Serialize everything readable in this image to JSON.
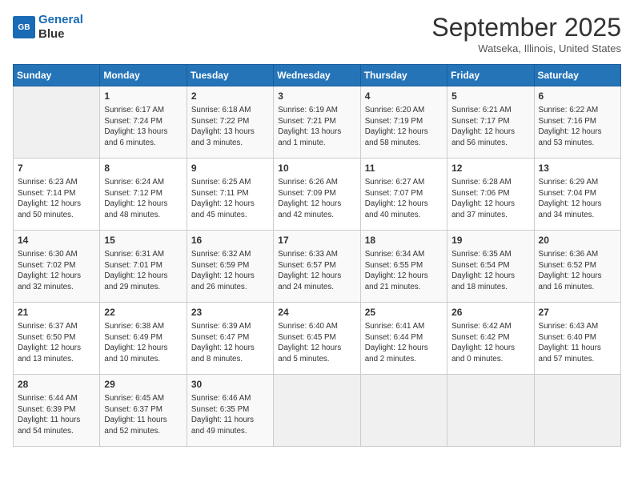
{
  "logo": {
    "line1": "General",
    "line2": "Blue"
  },
  "title": "September 2025",
  "location": "Watseka, Illinois, United States",
  "days_of_week": [
    "Sunday",
    "Monday",
    "Tuesday",
    "Wednesday",
    "Thursday",
    "Friday",
    "Saturday"
  ],
  "weeks": [
    [
      {
        "day": "",
        "info": ""
      },
      {
        "day": "1",
        "info": "Sunrise: 6:17 AM\nSunset: 7:24 PM\nDaylight: 13 hours\nand 6 minutes."
      },
      {
        "day": "2",
        "info": "Sunrise: 6:18 AM\nSunset: 7:22 PM\nDaylight: 13 hours\nand 3 minutes."
      },
      {
        "day": "3",
        "info": "Sunrise: 6:19 AM\nSunset: 7:21 PM\nDaylight: 13 hours\nand 1 minute."
      },
      {
        "day": "4",
        "info": "Sunrise: 6:20 AM\nSunset: 7:19 PM\nDaylight: 12 hours\nand 58 minutes."
      },
      {
        "day": "5",
        "info": "Sunrise: 6:21 AM\nSunset: 7:17 PM\nDaylight: 12 hours\nand 56 minutes."
      },
      {
        "day": "6",
        "info": "Sunrise: 6:22 AM\nSunset: 7:16 PM\nDaylight: 12 hours\nand 53 minutes."
      }
    ],
    [
      {
        "day": "7",
        "info": "Sunrise: 6:23 AM\nSunset: 7:14 PM\nDaylight: 12 hours\nand 50 minutes."
      },
      {
        "day": "8",
        "info": "Sunrise: 6:24 AM\nSunset: 7:12 PM\nDaylight: 12 hours\nand 48 minutes."
      },
      {
        "day": "9",
        "info": "Sunrise: 6:25 AM\nSunset: 7:11 PM\nDaylight: 12 hours\nand 45 minutes."
      },
      {
        "day": "10",
        "info": "Sunrise: 6:26 AM\nSunset: 7:09 PM\nDaylight: 12 hours\nand 42 minutes."
      },
      {
        "day": "11",
        "info": "Sunrise: 6:27 AM\nSunset: 7:07 PM\nDaylight: 12 hours\nand 40 minutes."
      },
      {
        "day": "12",
        "info": "Sunrise: 6:28 AM\nSunset: 7:06 PM\nDaylight: 12 hours\nand 37 minutes."
      },
      {
        "day": "13",
        "info": "Sunrise: 6:29 AM\nSunset: 7:04 PM\nDaylight: 12 hours\nand 34 minutes."
      }
    ],
    [
      {
        "day": "14",
        "info": "Sunrise: 6:30 AM\nSunset: 7:02 PM\nDaylight: 12 hours\nand 32 minutes."
      },
      {
        "day": "15",
        "info": "Sunrise: 6:31 AM\nSunset: 7:01 PM\nDaylight: 12 hours\nand 29 minutes."
      },
      {
        "day": "16",
        "info": "Sunrise: 6:32 AM\nSunset: 6:59 PM\nDaylight: 12 hours\nand 26 minutes."
      },
      {
        "day": "17",
        "info": "Sunrise: 6:33 AM\nSunset: 6:57 PM\nDaylight: 12 hours\nand 24 minutes."
      },
      {
        "day": "18",
        "info": "Sunrise: 6:34 AM\nSunset: 6:55 PM\nDaylight: 12 hours\nand 21 minutes."
      },
      {
        "day": "19",
        "info": "Sunrise: 6:35 AM\nSunset: 6:54 PM\nDaylight: 12 hours\nand 18 minutes."
      },
      {
        "day": "20",
        "info": "Sunrise: 6:36 AM\nSunset: 6:52 PM\nDaylight: 12 hours\nand 16 minutes."
      }
    ],
    [
      {
        "day": "21",
        "info": "Sunrise: 6:37 AM\nSunset: 6:50 PM\nDaylight: 12 hours\nand 13 minutes."
      },
      {
        "day": "22",
        "info": "Sunrise: 6:38 AM\nSunset: 6:49 PM\nDaylight: 12 hours\nand 10 minutes."
      },
      {
        "day": "23",
        "info": "Sunrise: 6:39 AM\nSunset: 6:47 PM\nDaylight: 12 hours\nand 8 minutes."
      },
      {
        "day": "24",
        "info": "Sunrise: 6:40 AM\nSunset: 6:45 PM\nDaylight: 12 hours\nand 5 minutes."
      },
      {
        "day": "25",
        "info": "Sunrise: 6:41 AM\nSunset: 6:44 PM\nDaylight: 12 hours\nand 2 minutes."
      },
      {
        "day": "26",
        "info": "Sunrise: 6:42 AM\nSunset: 6:42 PM\nDaylight: 12 hours\nand 0 minutes."
      },
      {
        "day": "27",
        "info": "Sunrise: 6:43 AM\nSunset: 6:40 PM\nDaylight: 11 hours\nand 57 minutes."
      }
    ],
    [
      {
        "day": "28",
        "info": "Sunrise: 6:44 AM\nSunset: 6:39 PM\nDaylight: 11 hours\nand 54 minutes."
      },
      {
        "day": "29",
        "info": "Sunrise: 6:45 AM\nSunset: 6:37 PM\nDaylight: 11 hours\nand 52 minutes."
      },
      {
        "day": "30",
        "info": "Sunrise: 6:46 AM\nSunset: 6:35 PM\nDaylight: 11 hours\nand 49 minutes."
      },
      {
        "day": "",
        "info": ""
      },
      {
        "day": "",
        "info": ""
      },
      {
        "day": "",
        "info": ""
      },
      {
        "day": "",
        "info": ""
      }
    ]
  ]
}
